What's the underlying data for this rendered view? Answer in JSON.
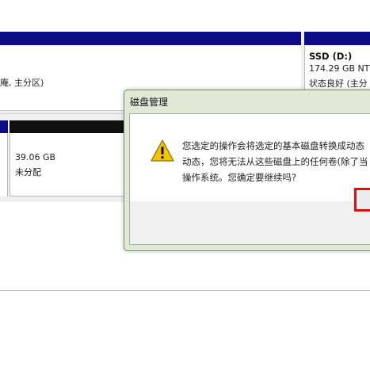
{
  "volumes": {
    "top_row_partial_label": "庵, 主分区)",
    "ssd": {
      "title": "SSD  (D:)",
      "size": "174.29 GB NT",
      "status": "状态良好 (主分"
    },
    "unallocated": {
      "size": "39.06 GB",
      "status": "未分配"
    }
  },
  "dialog": {
    "title": "磁盘管理",
    "message_lines": [
      "您选定的操作会将选定的基本磁盘转换成动态",
      "动态，您将无法从这些磁盘上的任何卷(除了当",
      "操作系统。您确定要继续吗?"
    ]
  },
  "colors": {
    "volume_bar_primary": "#0b0b88",
    "volume_bar_unallocated": "#101010",
    "highlight_box": "#e01010",
    "warning_icon": "#f5c400"
  },
  "icons": {
    "dialog_icon": "warning-icon"
  }
}
